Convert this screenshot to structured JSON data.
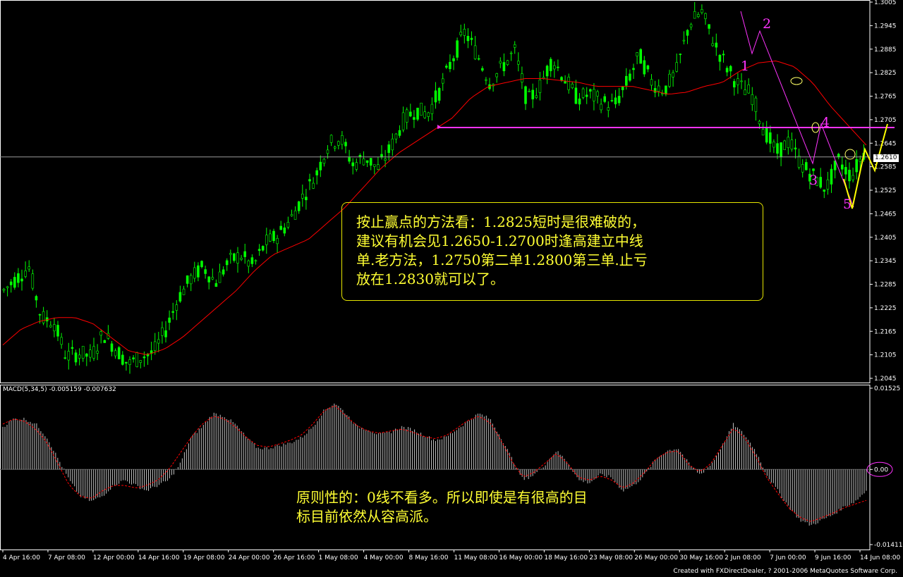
{
  "colors": {
    "background": "#000000",
    "candles": "#00ff00",
    "moving_average": "#ff0000",
    "horizontal_line": "#ff33ff",
    "wave_marks": "#ff33ff",
    "forecast_line": "#ffff00",
    "macd_histogram": "#c0c0c0",
    "macd_signal": "#ff0000",
    "annotation_text": "#ffff33"
  },
  "chart_data": [
    {
      "type": "candlestick",
      "title": "",
      "ylim": [
        1.2045,
        1.3005
      ],
      "y_ticks": [
        "1.3005",
        "1.2945",
        "1.2885",
        "1.2825",
        "1.2765",
        "1.2705",
        "1.2645",
        "1.2585",
        "1.2525",
        "1.2465",
        "1.2405",
        "1.2345",
        "1.2285",
        "1.2225",
        "1.2165",
        "1.2105",
        "1.2045"
      ],
      "x_ticks": [
        "4 Apr 16:00",
        "7 Apr 08:00",
        "12 Apr 00:00",
        "14 Apr 16:00",
        "19 Apr 08:00",
        "24 Apr 00:00",
        "26 Apr 16:00",
        "1 May 08:00",
        "4 May 00:00",
        "8 May 16:00",
        "11 May 08:00",
        "16 May 00:00",
        "18 May 16:00",
        "23 May 08:00",
        "26 May 00:00",
        "30 May 16:00",
        "2 Jun 08:00",
        "7 Jun 00:00",
        "9 Jun 16:00",
        "14 Jun 08:00"
      ],
      "close_path": [
        1.227,
        1.23,
        1.233,
        1.22,
        1.219,
        1.21,
        1.211,
        1.21,
        1.216,
        1.212,
        1.208,
        1.21,
        1.211,
        1.217,
        1.225,
        1.23,
        1.233,
        1.229,
        1.234,
        1.236,
        1.233,
        1.239,
        1.241,
        1.245,
        1.251,
        1.256,
        1.264,
        1.266,
        1.259,
        1.261,
        1.258,
        1.263,
        1.27,
        1.273,
        1.272,
        1.278,
        1.286,
        1.293,
        1.287,
        1.28,
        1.284,
        1.288,
        1.275,
        1.279,
        1.286,
        1.281,
        1.276,
        1.277,
        1.275,
        1.274,
        1.28,
        1.287,
        1.28,
        1.278,
        1.283,
        1.295,
        1.298,
        1.29,
        1.284,
        1.279,
        1.277,
        1.268,
        1.262,
        1.265,
        1.259,
        1.256,
        1.253,
        1.26,
        1.256,
        1.262
      ],
      "moving_average_path": [
        1.213,
        1.217,
        1.219,
        1.22,
        1.22,
        1.2185,
        1.215,
        1.2115,
        1.2105,
        1.212,
        1.215,
        1.219,
        1.223,
        1.227,
        1.232,
        1.236,
        1.238,
        1.24,
        1.244,
        1.248,
        1.253,
        1.258,
        1.262,
        1.265,
        1.268,
        1.271,
        1.276,
        1.279,
        1.28,
        1.281,
        1.281,
        1.2805,
        1.28,
        1.279,
        1.279,
        1.279,
        1.278,
        1.277,
        1.2775,
        1.279,
        1.28,
        1.283,
        1.285,
        1.2855,
        1.284,
        1.28,
        1.274,
        1.269,
        1.264
      ],
      "current_price": "1.2610",
      "horizontal_level": 1.2685,
      "wave_labels": [
        "1",
        "2",
        "3",
        "4",
        "5"
      ]
    },
    {
      "type": "bar",
      "title": "MACD(5,34,5)",
      "values_shown": [
        "-0.005159",
        "-0.007632"
      ],
      "ylim": [
        -0.01411,
        0.01525
      ],
      "y_ticks": [
        "0.01525",
        "0.00",
        "-0.01411"
      ],
      "histogram_path": [
        0.008,
        0.0095,
        0.0095,
        0.0085,
        0.006,
        0.002,
        -0.002,
        -0.005,
        -0.006,
        -0.005,
        -0.003,
        -0.002,
        -0.003,
        -0.004,
        -0.003,
        -0.002,
        0.001,
        0.006,
        0.008,
        0.0105,
        0.01,
        0.0085,
        0.006,
        0.004,
        0.004,
        0.0045,
        0.005,
        0.006,
        0.008,
        0.011,
        0.0125,
        0.0105,
        0.008,
        0.0075,
        0.0065,
        0.007,
        0.008,
        0.0075,
        0.0065,
        0.0055,
        0.006,
        0.0075,
        0.009,
        0.0105,
        0.0095,
        0.006,
        0.002,
        -0.002,
        -0.001,
        0.001,
        0.0035,
        0.0015,
        -0.002,
        -0.0025,
        -0.001,
        -0.0015,
        -0.004,
        -0.003,
        -0.001,
        0.002,
        0.0035,
        0.004,
        0.001,
        -0.001,
        0.001,
        0.0045,
        0.0085,
        0.0065,
        0.0035,
        -0.001,
        -0.004,
        -0.007,
        -0.0095,
        -0.0105,
        -0.0095,
        -0.0085,
        -0.007,
        -0.006,
        -0.004
      ],
      "signal_path": [
        0.0085,
        0.0095,
        0.009,
        0.0075,
        0.005,
        0.001,
        -0.003,
        -0.005,
        -0.0055,
        -0.004,
        -0.003,
        -0.003,
        -0.0035,
        -0.003,
        -0.002,
        0.0,
        0.003,
        0.006,
        0.0085,
        0.01,
        0.0095,
        0.008,
        0.006,
        0.0045,
        0.0042,
        0.0048,
        0.0055,
        0.0065,
        0.0085,
        0.011,
        0.012,
        0.01,
        0.0082,
        0.0072,
        0.0068,
        0.0072,
        0.0076,
        0.007,
        0.0062,
        0.0058,
        0.0063,
        0.0077,
        0.0092,
        0.01,
        0.0088,
        0.0055,
        0.0015,
        -0.0015,
        -0.0005,
        0.0012,
        0.003,
        0.0012,
        -0.0015,
        -0.002,
        -0.0012,
        -0.002,
        -0.0035,
        -0.0025,
        -0.0005,
        0.002,
        0.0032,
        0.0035,
        0.0008,
        -0.0005,
        0.0012,
        0.0045,
        0.0078,
        0.006,
        0.0025,
        -0.0015,
        -0.0045,
        -0.0072,
        -0.009,
        -0.0098,
        -0.009,
        -0.0082,
        -0.0072,
        -0.0065,
        -0.0058
      ]
    }
  ],
  "annotations": {
    "box_lines": [
      "按止赢点的方法看：1.2825短时是很难破的，",
      "建议有机会见1.2650-1.2700时逢高建立中线",
      "单.老方法，1.2750第二单1.2800第三单.止亏",
      "放在1.2830就可以了。"
    ],
    "macd_lines": [
      "原则性的：0线不看多。所以即使是有很高的目",
      "标目前依然从容高派。"
    ]
  },
  "footer": "Created with FXDirectDealer, ? 2001-2006 MetaQuotes Software Corp."
}
